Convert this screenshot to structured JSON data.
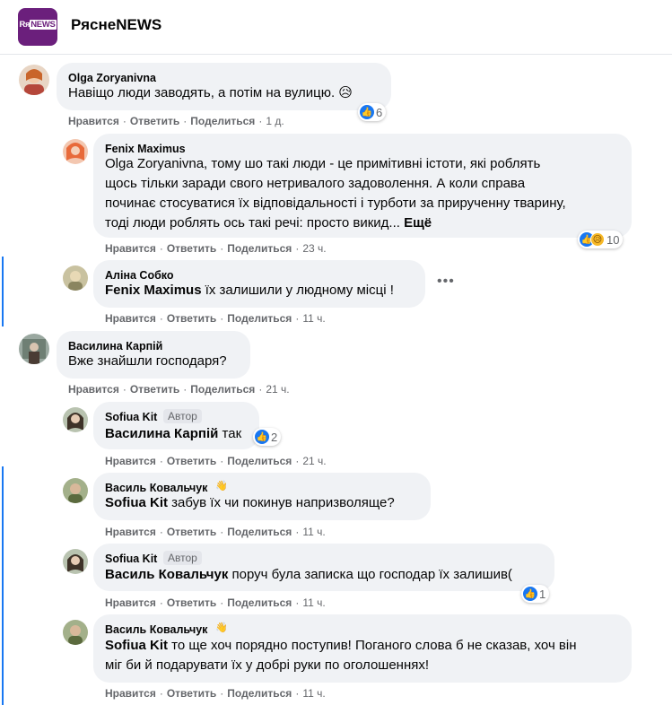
{
  "page": {
    "name": "РяснеNEWS",
    "logo_text_a": "Rя",
    "logo_text_b": "NEWS"
  },
  "actions": {
    "like": "Нравится",
    "reply": "Ответить",
    "share": "Поделиться",
    "sep": "·"
  },
  "comments": [
    {
      "author": "Olga Zoryanivna",
      "text": "Навіщо люди заводять, а потім на вулицю. 😥",
      "time": "1 д.",
      "reactions": "6"
    },
    {
      "author": "Fenix Maximus",
      "text_lines": [
        "Olga Zoryanivna, тому шо такі люди - це примітивні істоти, які роблять",
        "щось тільки заради свого нетривалого задоволення. А коли справа",
        "починає стосуватися їх відповідальності і турботи за прирученну тварину,",
        "тоді люди роблять ось такі речі: просто викид..."
      ],
      "more": "Ещё",
      "time": "23 ч.",
      "reactions": "10"
    },
    {
      "author": "Аліна Собко",
      "mention": "Fenix Maximus",
      "text": " їх залишили у людному місці !",
      "time": "11 ч."
    },
    {
      "author": "Василина Карпій",
      "text": "Вже знайшли господаря?",
      "time": "21 ч."
    },
    {
      "author": "Sofiua Kit",
      "badge": "Автор",
      "mention": "Василина Карпій",
      "text": " так",
      "time": "21 ч.",
      "reactions": "2"
    },
    {
      "author": "Василь Ковальчук",
      "wave": "👋",
      "mention": "Sofiua Kit",
      "text": " забув їх чи покинув напризволяще?",
      "time": "11 ч."
    },
    {
      "author": "Sofiua Kit",
      "badge": "Автор",
      "mention": "Василь Ковальчук",
      "text": " поруч була записка що господар їх залишив(",
      "time": "11 ч.",
      "reactions": "1"
    },
    {
      "author": "Василь Ковальчук",
      "wave": "👋",
      "mention": "Sofiua Kit",
      "text_line1": " то ще хоч порядно поступив! Поганого слова б не сказав, хоч він",
      "text_line2": "міг би й подарувати їх у добрі руки по оголошеннях!",
      "time": "11 ч."
    }
  ],
  "more_options": "•••",
  "colors": {
    "accent": "#1877f2",
    "bubble": "#f0f2f5",
    "muted": "#65676b",
    "brand": "#6b1f7c"
  }
}
